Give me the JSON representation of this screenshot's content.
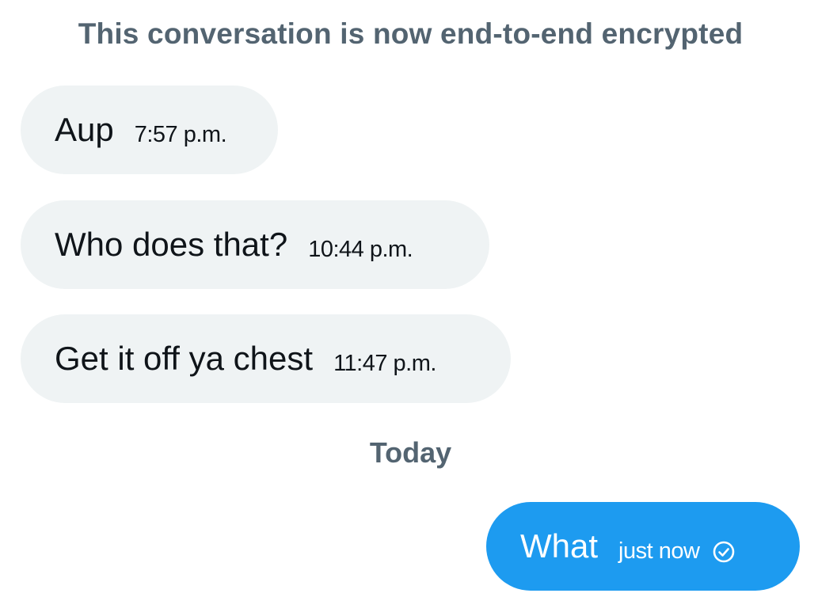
{
  "notice": "This conversation is now end-to-end encrypted",
  "messages": [
    {
      "text": "Aup",
      "time": "7:57 p.m."
    },
    {
      "text": "Who does that?",
      "time": "10:44 p.m."
    },
    {
      "text": "Get it off ya chest",
      "time": "11:47 p.m."
    }
  ],
  "day_separator": "Today",
  "sent": {
    "text": "What",
    "time": "just now",
    "status_icon": "sent-check-icon"
  },
  "colors": {
    "incoming_bubble": "#eff3f4",
    "outgoing_bubble": "#1d9bf0",
    "muted_text": "#536471",
    "text": "#0f1419"
  }
}
